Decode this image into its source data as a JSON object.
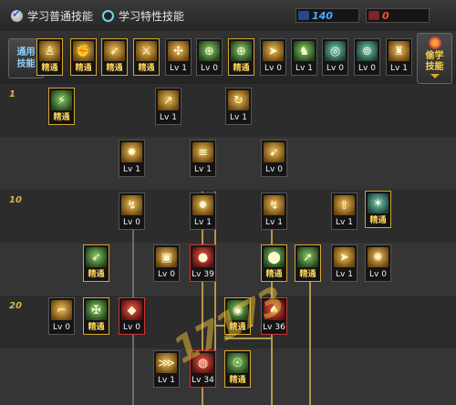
{
  "tabs": [
    {
      "label": "学习普通技能",
      "active": true
    },
    {
      "label": "学习特性技能",
      "active": false
    }
  ],
  "points": {
    "sp": {
      "value": "140",
      "color": "#4ea8ff"
    },
    "tp": {
      "value": "0",
      "color": "#ff4a3a"
    }
  },
  "icon_bar": {
    "category_button": {
      "line1": "通用",
      "line2": "技能"
    },
    "steal_button": {
      "line1": "偷学",
      "line2": "技能"
    },
    "skills": [
      {
        "icon": "sitting-figure-icon",
        "caption": "精通",
        "master": true
      },
      {
        "icon": "fist-strike-icon",
        "caption": "精通",
        "master": true
      },
      {
        "icon": "running-figure-icon",
        "caption": "精通",
        "master": true
      },
      {
        "icon": "crossed-blades-icon",
        "caption": "精通",
        "master": true
      },
      {
        "icon": "golden-wings-icon",
        "caption": "Lv 1",
        "master": false
      },
      {
        "icon": "green-crosshair-icon",
        "caption": "Lv 0",
        "master": false
      },
      {
        "icon": "green-crosshair-icon",
        "caption": "精通",
        "master": true
      },
      {
        "icon": "speed-runner-icon",
        "caption": "Lv 0",
        "master": false
      },
      {
        "icon": "green-warrior-icon",
        "caption": "Lv 1",
        "master": false
      },
      {
        "icon": "shield-swirl-icon",
        "caption": "Lv 0",
        "master": false
      },
      {
        "icon": "vortex-icon",
        "caption": "Lv 0",
        "master": false
      },
      {
        "icon": "golden-armor-icon",
        "caption": "Lv 1",
        "master": false
      },
      {
        "icon": "crouching-figure-icon",
        "caption": "Lv 0",
        "master": false
      }
    ]
  },
  "tier_labels": [
    "1",
    "10",
    "20"
  ],
  "tree_skills": [
    {
      "icon": "green-slash-icon",
      "caption": "精通",
      "master": true
    },
    {
      "icon": "upward-arrow-icon",
      "caption": "Lv 1",
      "master": false
    },
    {
      "icon": "spin-kick-icon",
      "caption": "Lv 1",
      "master": false
    },
    {
      "icon": "burst-icon",
      "caption": "Lv 1",
      "master": false
    },
    {
      "icon": "rapid-fire-icon",
      "caption": "Lv 1",
      "master": false
    },
    {
      "icon": "gun-shot-icon",
      "caption": "Lv 0",
      "master": false
    },
    {
      "icon": "lightning-arrow-icon",
      "caption": "Lv 0",
      "master": false
    },
    {
      "icon": "flame-burst-icon",
      "caption": "Lv 1",
      "master": false
    },
    {
      "icon": "lightning-claw-icon",
      "caption": "Lv 1",
      "master": false
    },
    {
      "icon": "upgrade-icon",
      "caption": "Lv 1",
      "master": false
    },
    {
      "icon": "tree-blast-icon",
      "caption": "精通",
      "master": true
    },
    {
      "icon": "bow-arrow-icon",
      "caption": "精通",
      "master": true
    },
    {
      "icon": "cannon-icon",
      "caption": "Lv 0",
      "master": false
    },
    {
      "icon": "red-grenade-icon",
      "caption": "Lv 39",
      "master": false
    },
    {
      "icon": "green-bomb-icon",
      "caption": "精通",
      "master": true
    },
    {
      "icon": "green-missile-icon",
      "caption": "精通",
      "master": true
    },
    {
      "icon": "running-shot-icon",
      "caption": "Lv 1",
      "master": false
    },
    {
      "icon": "explosion-icon",
      "caption": "Lv 0",
      "master": false
    },
    {
      "icon": "pistol-icon",
      "caption": "Lv 0",
      "master": false
    },
    {
      "icon": "crossbow-icon",
      "caption": "精通",
      "master": true
    },
    {
      "icon": "red-mine-icon",
      "caption": "Lv 0",
      "master": false
    },
    {
      "icon": "green-grenade-icon",
      "caption": "精通",
      "master": true
    },
    {
      "icon": "red-bomber-icon",
      "caption": "Lv 36",
      "master": false
    },
    {
      "icon": "multishot-icon",
      "caption": "Lv 1",
      "master": false
    },
    {
      "icon": "red-orb-icon",
      "caption": "Lv 34",
      "master": false
    },
    {
      "icon": "gas-grenade-icon",
      "caption": "精通",
      "master": true
    }
  ],
  "watermark": "17173"
}
